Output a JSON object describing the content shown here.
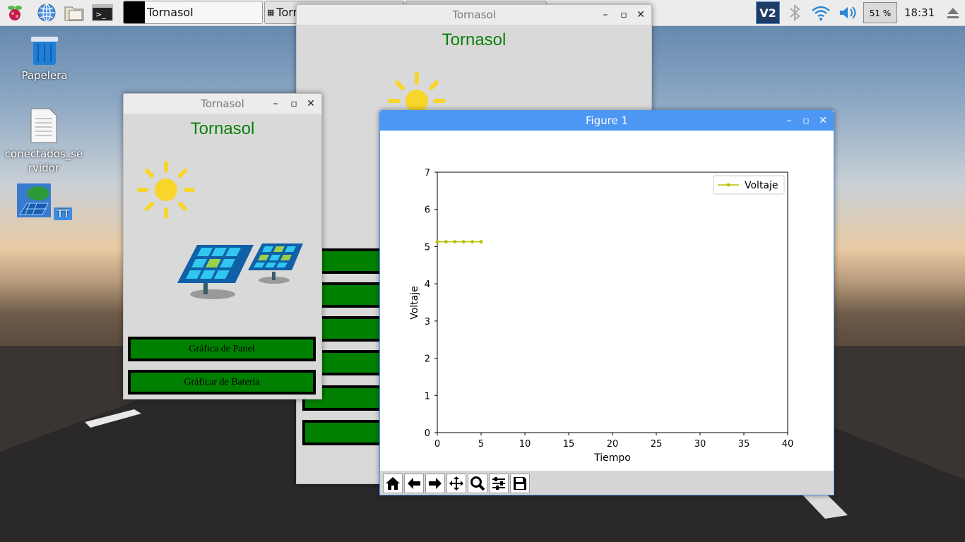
{
  "taskbar": {
    "tasks": [
      {
        "label": "Tornasol"
      },
      {
        "label": "Torr"
      }
    ],
    "battery": "51 %",
    "clock": "18:31",
    "tray_icons": [
      "vnc-icon",
      "bluetooth-icon",
      "wifi-icon",
      "volume-icon",
      "cpu-monitor-icon",
      "eject-icon"
    ]
  },
  "desktop": {
    "icons": [
      {
        "label": "Papelera"
      },
      {
        "label": "conectados_se rvidor"
      },
      {
        "label": "TT"
      }
    ]
  },
  "back_window": {
    "title": "Tornasol",
    "app_title": "Tornasol"
  },
  "front_window": {
    "title": "Tornasol",
    "app_title": "Tornasol",
    "buttons": [
      {
        "label": "Gráfica de Panel"
      },
      {
        "label": "Gráficar de Bateria"
      }
    ]
  },
  "figure_window": {
    "title": "Figure 1",
    "toolbar": [
      "home-icon",
      "back-icon",
      "forward-icon",
      "pan-icon",
      "zoom-icon",
      "configure-icon",
      "save-icon"
    ]
  },
  "chart_data": {
    "type": "line",
    "title": "",
    "xlabel": "Tiempo",
    "ylabel": "Voltaje",
    "xlim": [
      0,
      40
    ],
    "ylim": [
      0,
      7
    ],
    "xticks": [
      0,
      5,
      10,
      15,
      20,
      25,
      30,
      35,
      40
    ],
    "yticks": [
      0,
      1,
      2,
      3,
      4,
      5,
      6,
      7
    ],
    "legend_position": "top-right",
    "grid": false,
    "series": [
      {
        "name": "Voltaje",
        "color": "#bfbf00",
        "marker": "dot",
        "x": [
          0,
          1,
          2,
          3,
          4,
          5
        ],
        "y": [
          5.13,
          5.13,
          5.13,
          5.13,
          5.13,
          5.13
        ]
      }
    ]
  }
}
